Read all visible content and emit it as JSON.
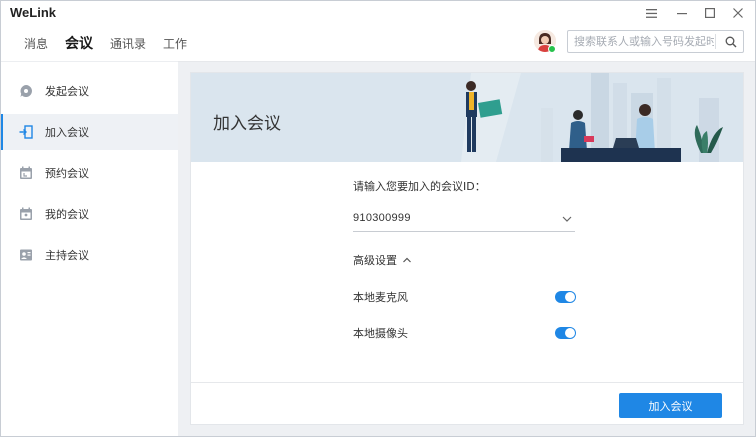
{
  "app": {
    "title": "WeLink"
  },
  "nav": {
    "tabs": [
      {
        "label": "消息"
      },
      {
        "label": "会议"
      },
      {
        "label": "通讯录"
      },
      {
        "label": "工作"
      }
    ],
    "active_tab": "会议"
  },
  "search": {
    "placeholder": "搜索联系人或输入号码发起时"
  },
  "sidebar": {
    "items": [
      {
        "label": "发起会议",
        "icon": "start-meeting-icon"
      },
      {
        "label": "加入会议",
        "icon": "join-meeting-icon"
      },
      {
        "label": "预约会议",
        "icon": "schedule-meeting-icon"
      },
      {
        "label": "我的会议",
        "icon": "my-meeting-icon"
      },
      {
        "label": "主持会议",
        "icon": "host-meeting-icon"
      }
    ],
    "active_item": "加入会议"
  },
  "join": {
    "title": "加入会议",
    "id_prompt": "请输入您要加入的会议ID：",
    "meeting_id": "910300999",
    "advanced_label": "高级设置",
    "options": [
      {
        "label": "本地麦克风",
        "enabled": true
      },
      {
        "label": "本地摄像头",
        "enabled": true
      }
    ],
    "submit_label": "加入会议"
  },
  "colors": {
    "accent": "#1f87e5",
    "banner_bg": "#dae5ee",
    "main_bg": "#eef0f3",
    "online_status": "#27c24c"
  }
}
